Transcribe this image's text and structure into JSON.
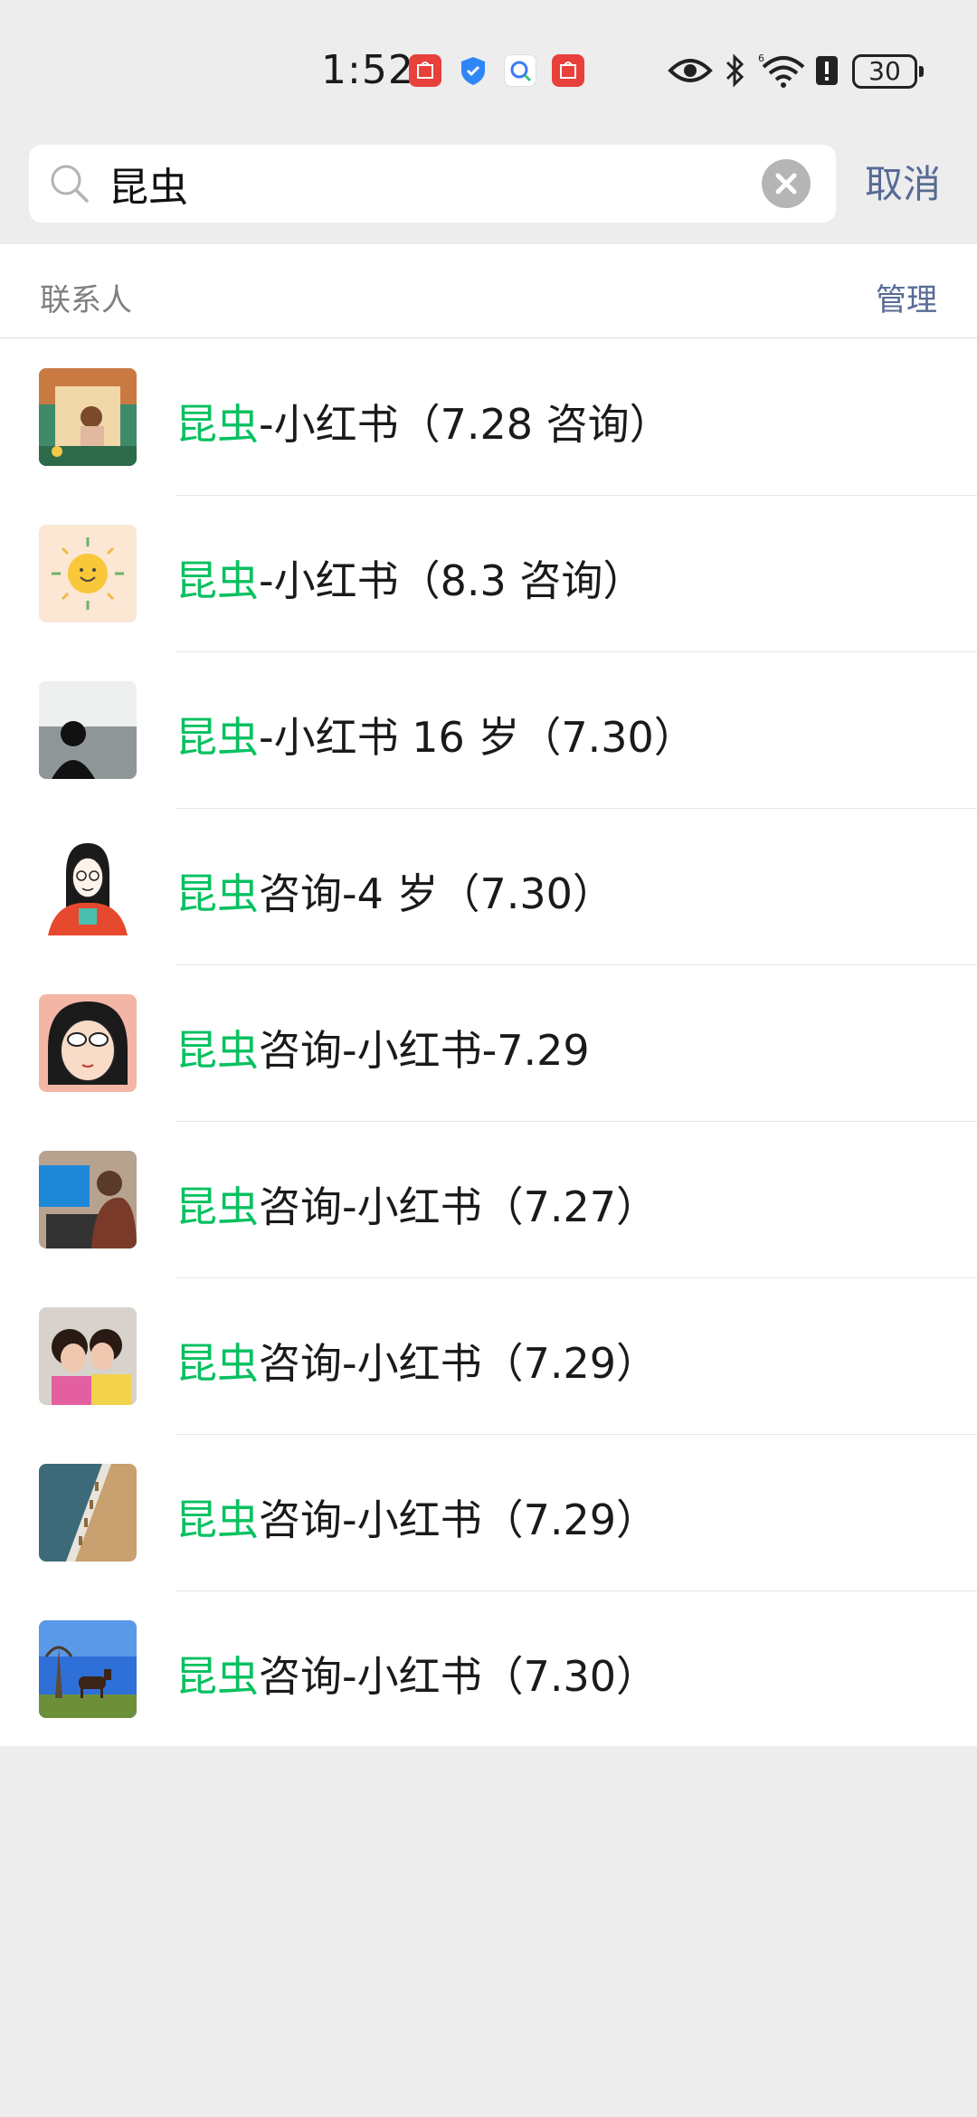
{
  "status_bar": {
    "time": "1:52",
    "battery": "30",
    "notification_icons": [
      "huawei-appgallery-icon",
      "shield-icon",
      "search-assistant-icon",
      "huawei-appgallery-icon"
    ],
    "system_icons": [
      "eye-icon",
      "bluetooth-icon",
      "wifi-6-icon",
      "alert-icon",
      "battery-icon"
    ]
  },
  "search": {
    "query": "昆虫",
    "cancel_label": "取消"
  },
  "section": {
    "title": "联系人",
    "manage_label": "管理"
  },
  "contacts": [
    {
      "highlight": "昆虫",
      "rest": "-小红书（7.28 咨询）",
      "avatar": "girl-window-illustration"
    },
    {
      "highlight": "昆虫",
      "rest": "-小红书（8.3 咨询）",
      "avatar": "sun-smiley"
    },
    {
      "highlight": "昆虫",
      "rest": "-小红书 16 岁（7.30）",
      "avatar": "silhouette-sea"
    },
    {
      "highlight": "昆虫",
      "rest": "咨询-4 岁（7.30）",
      "avatar": "woman-cartoon"
    },
    {
      "highlight": "昆虫",
      "rest": "咨询-小红书-7.29",
      "avatar": "girl-glasses-cartoon"
    },
    {
      "highlight": "昆虫",
      "rest": "咨询-小红书（7.27）",
      "avatar": "child-computer-photo"
    },
    {
      "highlight": "昆虫",
      "rest": "咨询-小红书（7.29）",
      "avatar": "two-kids-photo"
    },
    {
      "highlight": "昆虫",
      "rest": "咨询-小红书（7.29）",
      "avatar": "shore-photo"
    },
    {
      "highlight": "昆虫",
      "rest": "咨询-小红书（7.30）",
      "avatar": "horse-field-photo"
    }
  ],
  "colors": {
    "highlight": "#07c160",
    "link": "#576b95",
    "background": "#ededed"
  }
}
